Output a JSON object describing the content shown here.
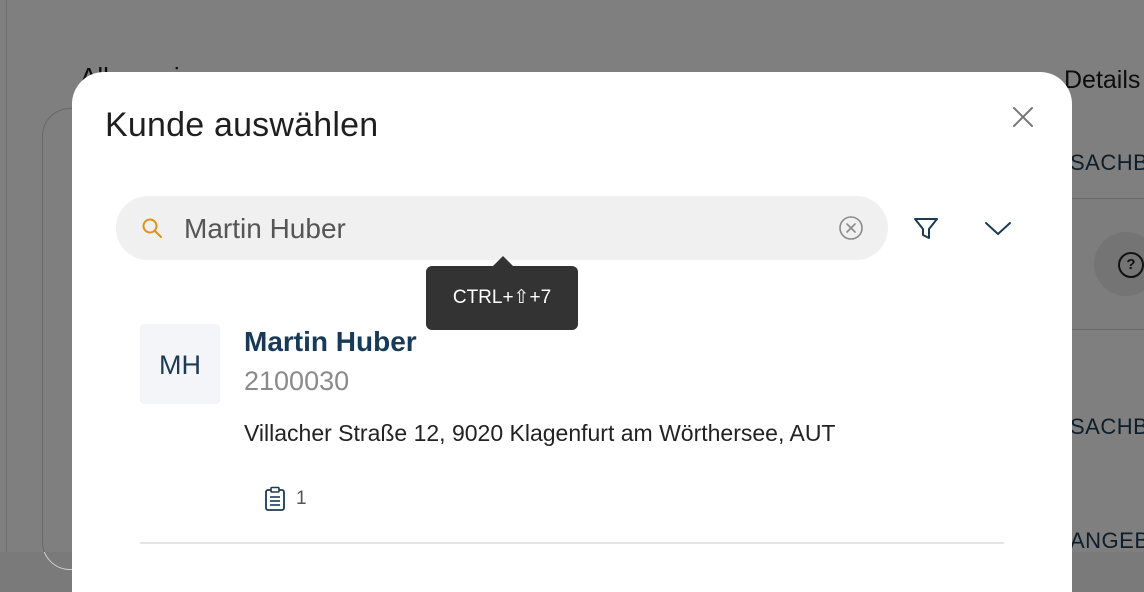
{
  "background": {
    "left_title": "Allgemein",
    "right_title": "Details",
    "right_rows": [
      "SACHB",
      "SACHB",
      "ANGEB"
    ]
  },
  "modal": {
    "title": "Kunde auswählen",
    "close_icon": "close-icon"
  },
  "search": {
    "value": "Martin Huber",
    "icon": "search-icon",
    "clear_icon": "clear-circle-icon"
  },
  "toolbar": {
    "filter_icon": "filter-icon",
    "expand_icon": "chevron-down-icon"
  },
  "tooltip": {
    "text": "CTRL+⇧+7"
  },
  "results": [
    {
      "initials": "MH",
      "name": "Martin Huber",
      "number": "2100030",
      "address": "Villacher Straße 12, 9020 Klagenfurt am Wörthersee, AUT",
      "documents_icon": "clipboard-icon",
      "documents_count": "1"
    }
  ],
  "colors": {
    "accent": "#E0911A",
    "name": "#163A57",
    "tooltip_bg": "#333333",
    "search_bg": "#F0F0F0"
  }
}
